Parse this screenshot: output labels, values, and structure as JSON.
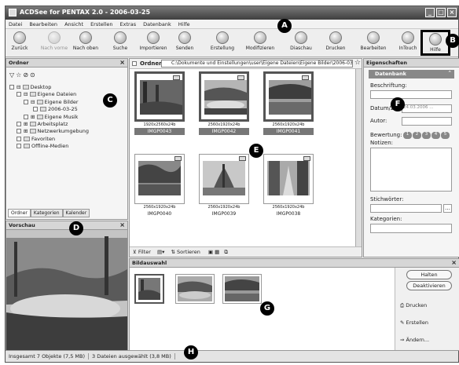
{
  "window": {
    "title": "ACDSee for PENTAX 2.0 - 2006-03-25"
  },
  "menu": [
    "Datei",
    "Bearbeiten",
    "Ansicht",
    "Erstellen",
    "Extras",
    "Datenbank",
    "Hilfe"
  ],
  "toolbar": {
    "back": "Zurück",
    "forward": "Nach vorne",
    "up": "Nach oben",
    "search": "Suche",
    "import": "Importieren",
    "send": "Senden",
    "create": "Erstellung",
    "modify": "Modifizieren",
    "slideshow": "Diaschau",
    "print": "Drucken",
    "edit": "Bearbeiten",
    "intouch": "InTouch",
    "help": "Hilfe"
  },
  "callouts": {
    "a": "A",
    "b": "B",
    "c": "C",
    "d": "D",
    "e": "E",
    "f": "F",
    "g": "G",
    "h": "H"
  },
  "folders": {
    "title": "Ordner",
    "tree": [
      "Desktop",
      "Eigene Dateien",
      "Eigene Bilder",
      "2006-03-25",
      "Eigene Musik",
      "Arbeitsplatz",
      "Netzwerkumgebung",
      "Favoriten",
      "Offline-Medien"
    ],
    "tabs": [
      "Ordner",
      "Kategorien",
      "Kalender"
    ]
  },
  "preview": {
    "title": "Vorschau"
  },
  "path": {
    "label": "Ordner:",
    "value": "C:\\Dokumente und Einstellungen\\user\\Eigene Dateien\\Eigene Bilder\\2006-03"
  },
  "thumbs": [
    {
      "dim": "1920x2560x24b",
      "name": "IMGP0043"
    },
    {
      "dim": "2560x1920x24b",
      "name": "IMGP0042"
    },
    {
      "dim": "2560x1920x24b",
      "name": "IMGP0041"
    },
    {
      "dim": "2560x1920x24b",
      "name": "IMGP0040"
    },
    {
      "dim": "2560x1920x24b",
      "name": "IMGP0039"
    },
    {
      "dim": "2560x1920x24b",
      "name": "IMGP0038"
    }
  ],
  "filterbar": {
    "filter": "Filter",
    "sort": "Sortieren"
  },
  "properties": {
    "title": "Eigenschaften",
    "section": "Datenbank",
    "caption": "Beschriftung:",
    "datetime": "Datum/Zeit:",
    "datetime_value": "24.03.2006 ...",
    "author": "Autor:",
    "rating": "Bewertung:",
    "rating_values": [
      "1",
      "2",
      "3",
      "4",
      "5"
    ],
    "notes": "Notizen:",
    "keywords": "Stichwörter:",
    "categories": "Kategorien:"
  },
  "selection": {
    "title": "Bildauswahl",
    "hold": "Halten",
    "deactivate": "Deaktivieren",
    "print": "Drucken",
    "create": "Erstellen",
    "change": "Ändern..."
  },
  "status": {
    "total": "Insgesamt 7 Objekte  (7,5 MB)",
    "selected": "3 Dateien ausgewählt (3,8 MB)"
  }
}
